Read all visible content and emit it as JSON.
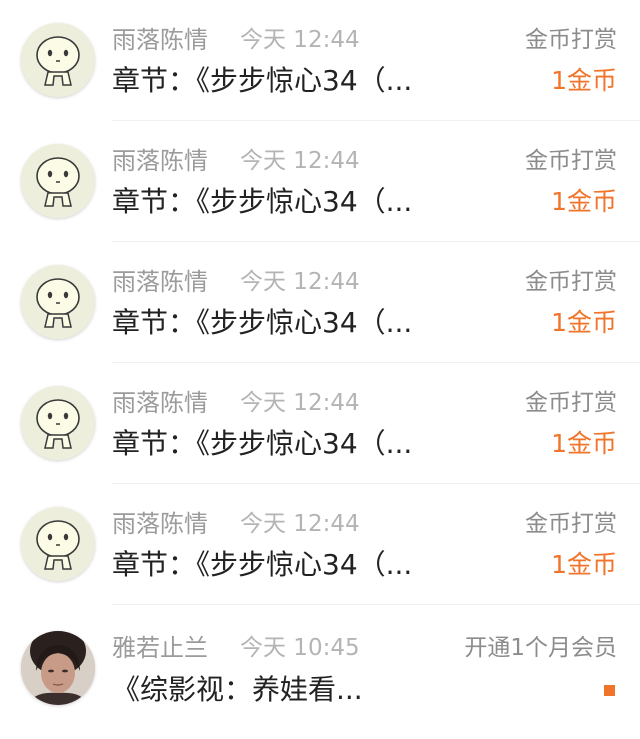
{
  "colors": {
    "accent_orange": "#f0752a",
    "name_gray": "#9b9b9b",
    "time_gray": "#b4b4b4",
    "title_dark": "#222222",
    "avatar_bg": "#eeeedc"
  },
  "rewards": [
    {
      "avatar_icon": "cartoon-face-avatar",
      "name": "雨落陈情",
      "time": "今天 12:44",
      "type": "金币打赏",
      "title": "章节：《步步惊心34（...",
      "amount": "1金币"
    },
    {
      "avatar_icon": "cartoon-face-avatar",
      "name": "雨落陈情",
      "time": "今天 12:44",
      "type": "金币打赏",
      "title": "章节：《步步惊心34（...",
      "amount": "1金币"
    },
    {
      "avatar_icon": "cartoon-face-avatar",
      "name": "雨落陈情",
      "time": "今天 12:44",
      "type": "金币打赏",
      "title": "章节：《步步惊心34（...",
      "amount": "1金币"
    },
    {
      "avatar_icon": "cartoon-face-avatar",
      "name": "雨落陈情",
      "time": "今天 12:44",
      "type": "金币打赏",
      "title": "章节：《步步惊心34（...",
      "amount": "1金币"
    },
    {
      "avatar_icon": "cartoon-face-avatar",
      "name": "雨落陈情",
      "time": "今天 12:44",
      "type": "金币打赏",
      "title": "章节：《步步惊心34（...",
      "amount": "1金币"
    },
    {
      "avatar_icon": "user-photo-avatar",
      "name": "雅若止兰",
      "time": "今天 10:45",
      "type": "开通1个月会员",
      "title": "《综影视：养娃看...",
      "amount": ""
    }
  ]
}
